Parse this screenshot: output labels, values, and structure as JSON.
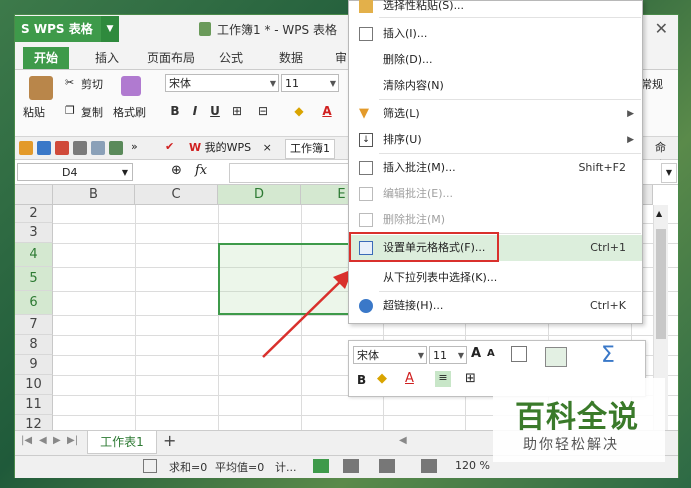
{
  "app": {
    "name": "WPS 表格",
    "doc_title": "工作簿1 * - WPS 表格"
  },
  "tabs": [
    "开始",
    "插入",
    "页面布局",
    "公式",
    "数据",
    "审"
  ],
  "clipboard": {
    "paste": "粘贴",
    "cut": "剪切",
    "copy": "复制",
    "format_painter": "格式刷"
  },
  "font": {
    "name": "宋体",
    "size": "11"
  },
  "number_format": "常规",
  "quickbar": {
    "my_wps": "我的WPS",
    "book": "工作簿1",
    "cmd": "命令"
  },
  "formula_bar": {
    "cell_ref": "D4",
    "fx": "fx"
  },
  "columns": [
    "B",
    "C",
    "D",
    "E"
  ],
  "rows": [
    "2",
    "3",
    "4",
    "5",
    "6",
    "7",
    "8",
    "9",
    "10",
    "11",
    "12"
  ],
  "context_menu": {
    "items": [
      {
        "label": "选择性粘贴(S)...",
        "shortcut": "",
        "disabled": false,
        "submenu": false
      },
      {
        "label": "插入(I)...",
        "shortcut": "",
        "disabled": false,
        "submenu": false
      },
      {
        "label": "删除(D)...",
        "shortcut": "",
        "disabled": false,
        "submenu": false
      },
      {
        "label": "清除内容(N)",
        "shortcut": "",
        "disabled": false,
        "submenu": false
      },
      {
        "label": "筛选(L)",
        "shortcut": "",
        "disabled": false,
        "submenu": true
      },
      {
        "label": "排序(U)",
        "shortcut": "",
        "disabled": false,
        "submenu": true
      },
      {
        "label": "插入批注(M)...",
        "shortcut": "Shift+F2",
        "disabled": false,
        "submenu": false
      },
      {
        "label": "编辑批注(E)...",
        "shortcut": "",
        "disabled": true,
        "submenu": false
      },
      {
        "label": "删除批注(M)",
        "shortcut": "",
        "disabled": true,
        "submenu": false
      },
      {
        "label": "设置单元格格式(F)...",
        "shortcut": "Ctrl+1",
        "disabled": false,
        "submenu": false
      },
      {
        "label": "从下拉列表中选择(K)...",
        "shortcut": "",
        "disabled": false,
        "submenu": false
      },
      {
        "label": "超链接(H)...",
        "shortcut": "Ctrl+K",
        "disabled": false,
        "submenu": false
      }
    ]
  },
  "mini_toolbar": {
    "font": "宋体",
    "size": "11",
    "bold": "B"
  },
  "sheet_tab": "工作表1",
  "add_sheet": "+",
  "status": {
    "sum": "求和=0",
    "avg": "平均值=0",
    "count": "计...",
    "zoom": "120 %"
  },
  "watermark": {
    "title": "百科全说",
    "subtitle": "助你轻松解决"
  },
  "colors": {
    "accent": "#3e9a4a",
    "highlight": "#dceedc",
    "annotation": "#d9302c"
  }
}
